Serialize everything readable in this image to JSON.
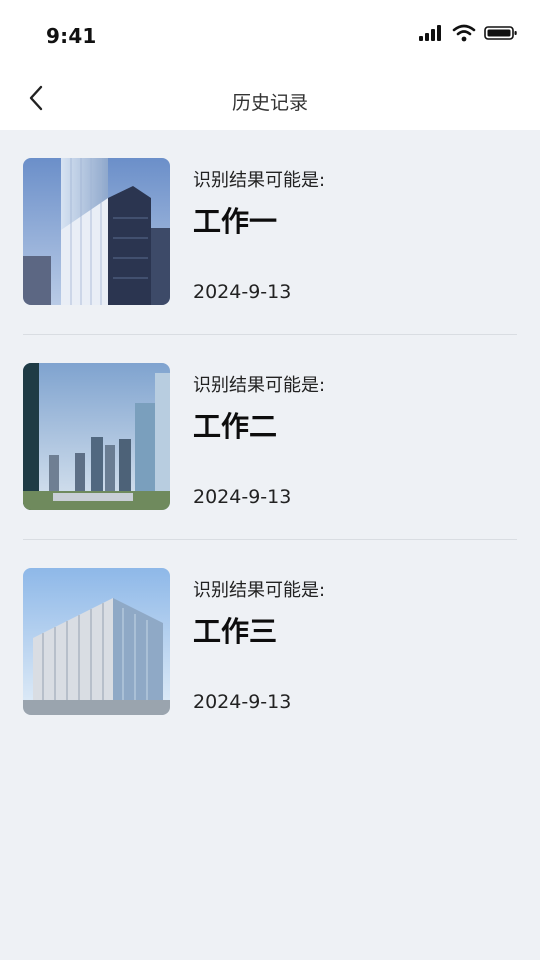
{
  "status_bar": {
    "time": "9:41",
    "icons": [
      "signal-icon",
      "wifi-icon",
      "battery-icon"
    ]
  },
  "nav": {
    "back_icon": "chevron-left-icon",
    "title": "历史记录"
  },
  "history": [
    {
      "caption": "识别结果可能是:",
      "result": "工作一",
      "date": "2024-9-13"
    },
    {
      "caption": "识别结果可能是:",
      "result": "工作二",
      "date": "2024-9-13"
    },
    {
      "caption": "识别结果可能是:",
      "result": "工作三",
      "date": "2024-9-13"
    }
  ],
  "colors": {
    "background": "#eef1f5",
    "header": "#ffffff",
    "divider": "#d9dde2"
  }
}
